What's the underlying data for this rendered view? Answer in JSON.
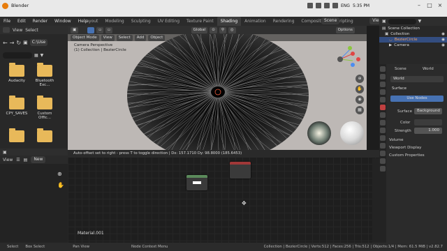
{
  "window": {
    "title": "Blender",
    "time": "5:35 PM",
    "lang": "ENG"
  },
  "menu": {
    "items": [
      "File",
      "Edit",
      "Render",
      "Window",
      "Help"
    ],
    "tabs": [
      "Layout",
      "Modeling",
      "Sculpting",
      "UV Editing",
      "Texture Paint",
      "Shading",
      "Animation",
      "Rendering",
      "Compositing",
      "Scripting"
    ],
    "active_tab": "Shading",
    "scene": "Scene",
    "view_layer": "View Layer"
  },
  "filebrowser": {
    "header": [
      "View",
      "Select"
    ],
    "path": "C:\\Use",
    "items": [
      "Audacity",
      "Bluetooth Exc...",
      "CPY_SAVES",
      "Custom Offic...",
      "",
      ""
    ]
  },
  "leftbottom": {
    "view": "View",
    "new": "New"
  },
  "viewport": {
    "mode": "Object Mode",
    "menus": [
      "View",
      "Select",
      "Add",
      "Object"
    ],
    "orientation": "Global",
    "options": "Options",
    "camera_label": "Camera Perspective",
    "collection_label": "(1) Collection | BezierCircle"
  },
  "nodeeditor": {
    "status_msg": "Auto-offset set to right - press T to toggle direction | Dx: 157.1710   Dy: 98.8000 (185.6453)",
    "material": "Material.001"
  },
  "outliner": {
    "title": "Scene Collection",
    "items": [
      "Collection",
      "BezierCircle",
      "Camera"
    ]
  },
  "props": {
    "scene": "Scene",
    "world_tab": "World",
    "world_name": "World",
    "surface_section": "Surface",
    "use_nodes": "Use Nodes",
    "surface_label": "Surface",
    "surface_value": "Background",
    "color_label": "Color",
    "strength_label": "Strength",
    "strength_value": "1.000",
    "sections": [
      "Volume",
      "Viewport Display",
      "Custom Properties"
    ]
  },
  "statusbar": {
    "items": [
      "Select",
      "Box Select",
      "Pan View",
      "Node Context Menu"
    ],
    "info": "Collection | BezierCircle | Verts:512 | Faces:256 | Tris:512 | Objects:1/4 | Mem: 61.5 MiB | v2.82.7"
  }
}
